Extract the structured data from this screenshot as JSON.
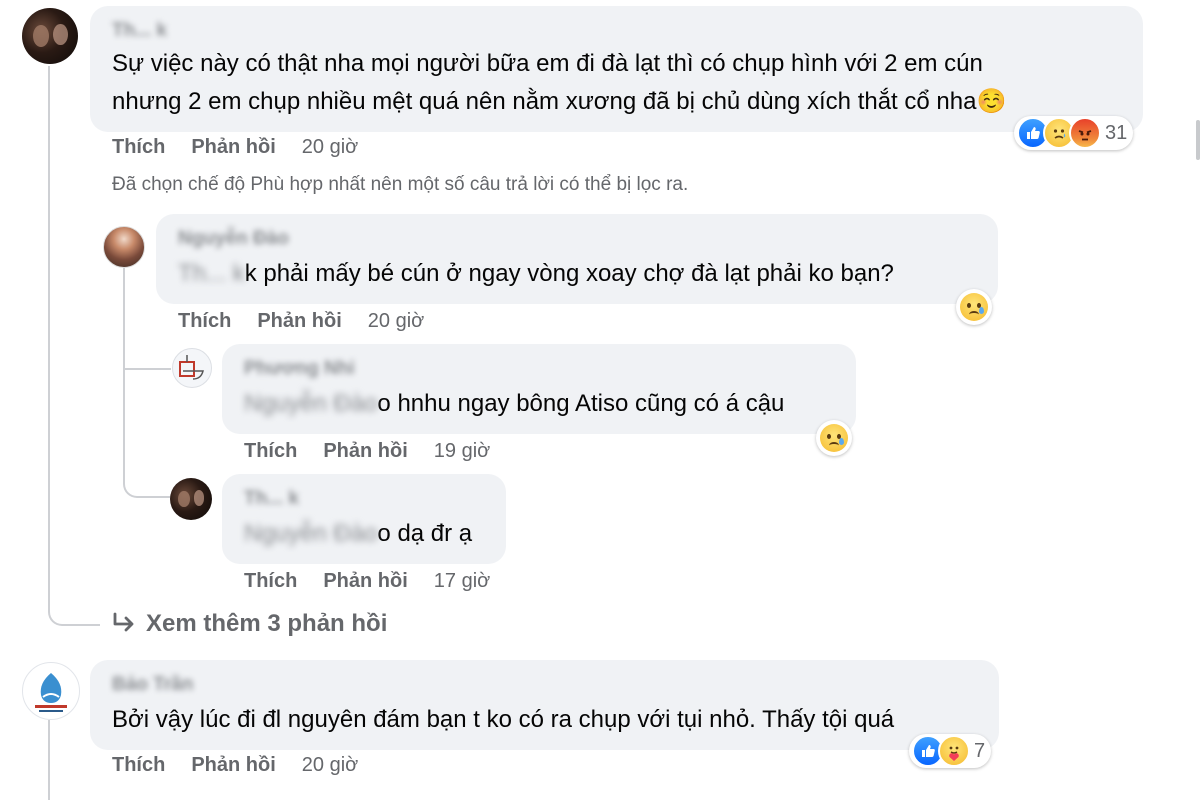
{
  "labels": {
    "like": "Thích",
    "reply": "Phản hồi"
  },
  "comments": [
    {
      "author": "Th... k",
      "text_line1": "Sự việc này có thật nha mọi người bữa em đi đà lạt thì có chụp hình với 2 em cún",
      "text_line2": "nhưng 2 em chụp nhiều mệt quá nên nằm xương đã bị chủ dùng xích thắt cổ nha",
      "emoji": "☺️",
      "time": "20 giờ",
      "reaction_icons": [
        "like-icon",
        "sad-icon",
        "angry-icon"
      ],
      "reaction_count": "31"
    },
    {
      "author": "Bảo Trần",
      "text": "Bởi vậy lúc đi đl nguyên đám bạn t ko có ra chụp với tụi nhỏ. Thấy tội quá",
      "time": "20 giờ",
      "reaction_icons": [
        "like-icon",
        "care-icon"
      ],
      "reaction_count": "7"
    }
  ],
  "filter_note": "Đã chọn chế độ Phù hợp nhất nên một số câu trả lời có thể bị lọc ra.",
  "replies": [
    {
      "author": "Nguyễn Đào",
      "mention": "Th... k",
      "text": "k phải mấy bé cún ở ngay vòng xoay chợ đà lạt phải ko bạn?",
      "time": "20 giờ",
      "reaction_icon": "sad-icon"
    },
    {
      "author": "Phương Nhi",
      "mention": "Nguyễn Đào",
      "text": "o hnhu ngay bông Atiso cũng có á cậu",
      "time": "19 giờ",
      "reaction_icon": "sad-icon"
    },
    {
      "author": "Th... k",
      "mention": "Nguyễn Đào",
      "text": "o dạ đr ạ",
      "time": "17 giờ"
    }
  ],
  "more_replies": "Xem thêm 3 phản hồi",
  "more_replies_icon": "reply-arrow-icon",
  "colors": {
    "bubble": "#f0f2f5",
    "meta": "#65676b",
    "like_blue": "#0866ff"
  }
}
